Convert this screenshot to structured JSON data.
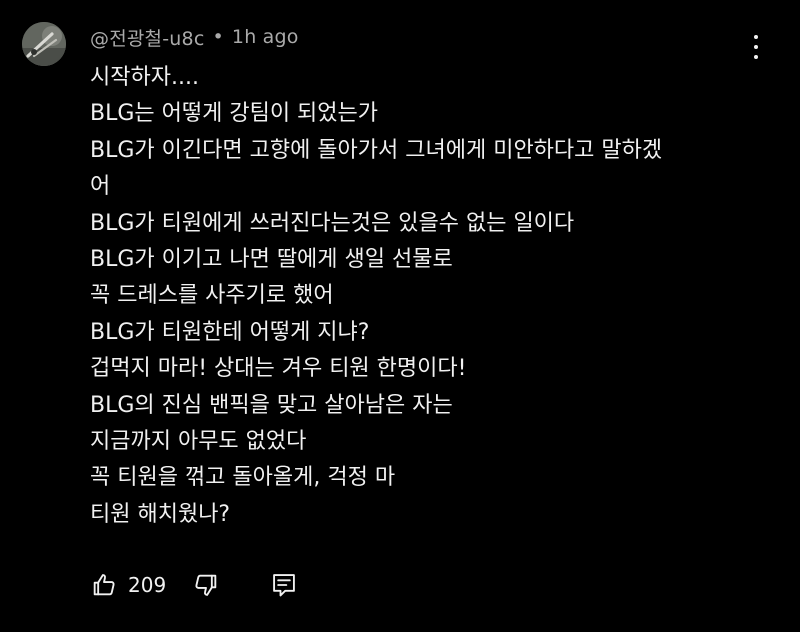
{
  "comment": {
    "author": "@전광철-u8c",
    "separator": "•",
    "time": "1h ago",
    "lines": [
      "시작하자....",
      "BLG는 어떻게 강팀이 되었는가",
      "BLG가 이긴다면 고향에 돌아가서 그녀에게 미안하다고 말하겠",
      "어",
      "BLG가 티원에게 쓰러진다는것은 있을수 없는 일이다",
      "BLG가 이기고 나면 딸에게 생일 선물로",
      "꼭 드레스를 사주기로 했어",
      "BLG가 티원한테 어떻게 지냐?",
      "겁먹지 마라! 상대는 겨우 티원 한명이다!",
      "BLG의 진심 밴픽을 맞고 살아남은 자는",
      "지금까지 아무도 없었다",
      "꼭 티원을 꺾고 돌아올게, 걱정 마",
      "티원 해치웠나?"
    ],
    "like_count": "209"
  },
  "icons": {
    "avatar": "avatar-image",
    "more": "more-vertical-icon",
    "like": "thumbs-up-icon",
    "dislike": "thumbs-down-icon",
    "reply": "reply-icon"
  },
  "colors": {
    "background": "#000000",
    "text": "#f1f1f1",
    "meta": "#aaaaaa"
  }
}
